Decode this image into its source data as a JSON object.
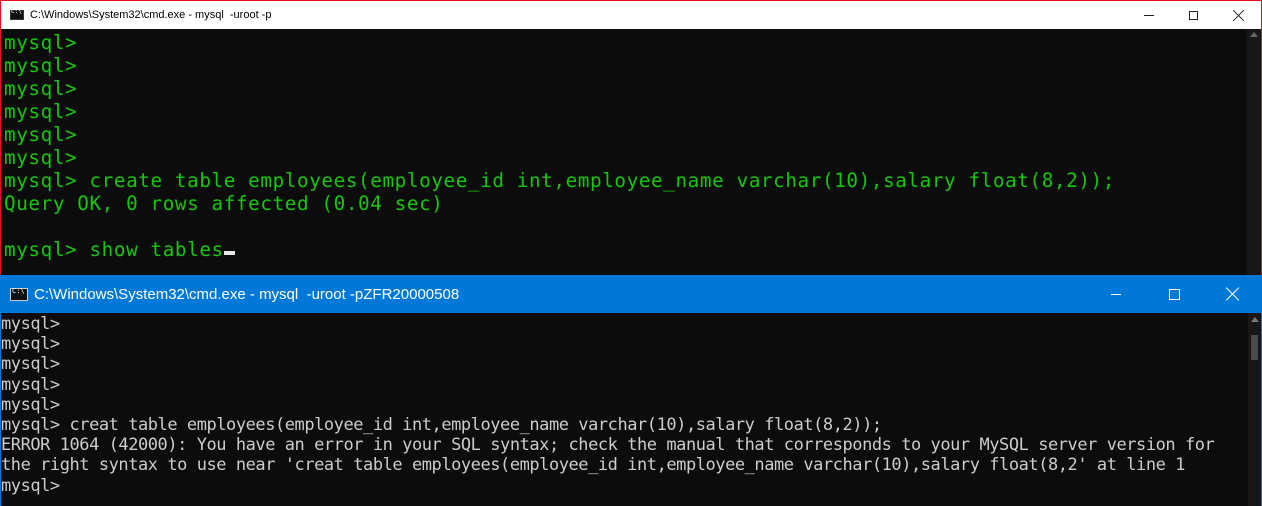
{
  "window1": {
    "title": "C:\\Windows\\System32\\cmd.exe - mysql  -uroot -p",
    "text_color": "#16c60c",
    "background": "#0c0c0c",
    "lines": [
      "mysql>",
      "mysql>",
      "mysql>",
      "mysql>",
      "mysql>",
      "mysql>",
      "mysql> create table employees(employee_id int,employee_name varchar(10),salary float(8,2));",
      "Query OK, 0 rows affected (0.04 sec)",
      "",
      "mysql> show tables"
    ],
    "controls": {
      "minimize": "minimize",
      "maximize": "maximize",
      "close": "close"
    }
  },
  "window2": {
    "title": "C:\\Windows\\System32\\cmd.exe - mysql  -uroot -pZFR20000508",
    "titlebar_color": "#0078d7",
    "text_color": "#cccccc",
    "lines": [
      "mysql>",
      "mysql>",
      "mysql>",
      "mysql>",
      "mysql>",
      "mysql> creat table employees(employee_id int,employee_name varchar(10),salary float(8,2));",
      "ERROR 1064 (42000): You have an error in your SQL syntax; check the manual that corresponds to your MySQL server version for",
      "the right syntax to use near 'creat table employees(employee_id int,employee_name varchar(10),salary float(8,2' at line 1",
      "mysql>"
    ],
    "controls": {
      "minimize": "minimize",
      "maximize": "maximize",
      "close": "close"
    }
  }
}
